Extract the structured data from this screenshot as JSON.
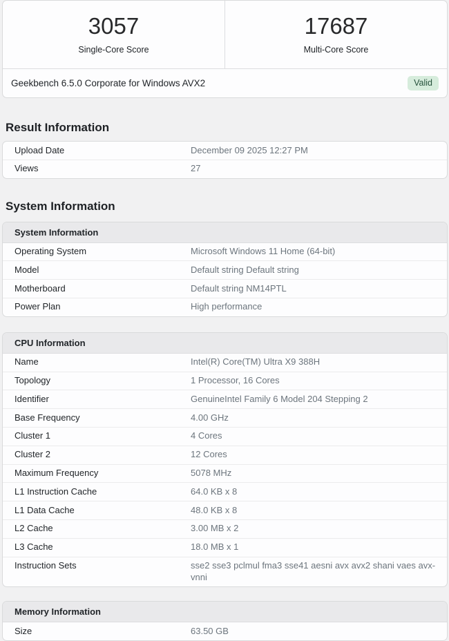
{
  "page": {
    "background": "#f1f1f2"
  },
  "score_card": {
    "scores": [
      {
        "value": "3057",
        "label": "Single-Core Score"
      },
      {
        "value": "17687",
        "label": "Multi-Core Score"
      }
    ],
    "version": "Geekbench 6.5.0 Corporate for Windows AVX2",
    "badge": {
      "label": "Valid",
      "bg": "#d6ecdc",
      "color": "#24503a"
    }
  },
  "result_section": {
    "heading": "Result Information",
    "rows": [
      {
        "label": "Upload Date",
        "value": "December 09 2025 12:27 PM"
      },
      {
        "label": "Views",
        "value": "27"
      }
    ]
  },
  "system_section": {
    "heading": "System Information",
    "system_card": {
      "header": "System Information",
      "rows": [
        {
          "label": "Operating System",
          "value": "Microsoft Windows 11 Home (64-bit)"
        },
        {
          "label": "Model",
          "value": "Default string Default string"
        },
        {
          "label": "Motherboard",
          "value": "Default string NM14PTL"
        },
        {
          "label": "Power Plan",
          "value": "High performance"
        }
      ]
    },
    "cpu_card": {
      "header": "CPU Information",
      "rows": [
        {
          "label": "Name",
          "value": "Intel(R) Core(TM) Ultra X9 388H"
        },
        {
          "label": "Topology",
          "value": "1 Processor, 16 Cores"
        },
        {
          "label": "Identifier",
          "value": "GenuineIntel Family 6 Model 204 Stepping 2"
        },
        {
          "label": "Base Frequency",
          "value": "4.00 GHz"
        },
        {
          "label": "Cluster 1",
          "value": "4 Cores"
        },
        {
          "label": "Cluster 2",
          "value": "12 Cores"
        },
        {
          "label": "Maximum Frequency",
          "value": "5078 MHz"
        },
        {
          "label": "L1 Instruction Cache",
          "value": "64.0 KB x 8"
        },
        {
          "label": "L1 Data Cache",
          "value": "48.0 KB x 8"
        },
        {
          "label": "L2 Cache",
          "value": "3.00 MB x 2"
        },
        {
          "label": "L3 Cache",
          "value": "18.0 MB x 1"
        },
        {
          "label": "Instruction Sets",
          "value": "sse2 sse3 pclmul fma3 sse41 aesni avx avx2 shani vaes avx-vnni"
        }
      ]
    },
    "memory_card": {
      "header": "Memory Information",
      "rows": [
        {
          "label": "Size",
          "value": "63.50 GB"
        }
      ]
    }
  }
}
